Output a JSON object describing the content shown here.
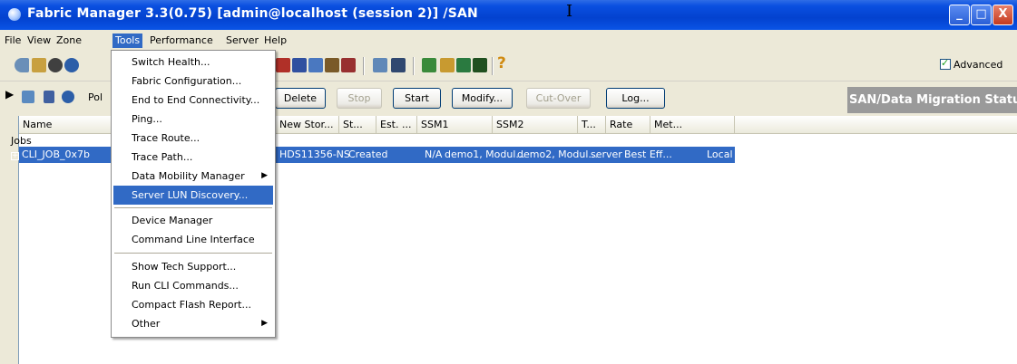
{
  "window": {
    "title": "Fabric Manager 3.3(0.75) [admin@localhost (session 2)] /SAN",
    "controls": [
      "_",
      "□",
      "X"
    ]
  },
  "menubar": [
    "File",
    "View",
    "Zone",
    "Tools",
    "Performance",
    "Server",
    "Help"
  ],
  "toolbar": {
    "advanced_label": "Advanced",
    "advanced_checked": true
  },
  "tools_menu": {
    "items": [
      {
        "label": "Switch Health..."
      },
      {
        "label": "Fabric Configuration..."
      },
      {
        "label": "End to End Connectivity..."
      },
      {
        "label": "Ping..."
      },
      {
        "label": "Trace Route..."
      },
      {
        "label": "Trace Path..."
      },
      {
        "label": "Data Mobility Manager",
        "submenu": true
      },
      {
        "label": "Server LUN Discovery...",
        "highlighted": true
      },
      {
        "label": "Device Manager"
      },
      {
        "label": "Command Line Interface"
      },
      {
        "label": "Show Tech Support..."
      },
      {
        "label": "Run CLI Commands..."
      },
      {
        "label": "Compact Flash Report..."
      },
      {
        "label": "Other",
        "submenu": true
      }
    ]
  },
  "actionbar": {
    "left_text": "Pol",
    "buttons": [
      {
        "label": "Delete",
        "enabled": true
      },
      {
        "label": "Stop",
        "enabled": false
      },
      {
        "label": "Start",
        "enabled": true
      },
      {
        "label": "Modify...",
        "enabled": true
      },
      {
        "label": "Cut-Over",
        "enabled": false
      },
      {
        "label": "Log...",
        "enabled": true
      }
    ],
    "status_title": "SAN/Data Migration Status"
  },
  "table": {
    "columns": [
      "Name",
      "New Stor...",
      "St...",
      "Est. ...",
      "SSM1",
      "SSM2",
      "T...",
      "Rate",
      "Met..."
    ],
    "group_label": "Jobs",
    "rows": [
      {
        "name": "CLI_JOB_0x7b",
        "new_storage": "HDS11356-NS",
        "status": "Created",
        "est": "N/A",
        "ssm1": "demo1, Modul...",
        "ssm2": "demo2, Modul...",
        "type": "server",
        "rate": "Best Eff...",
        "method": "Local"
      }
    ]
  },
  "colors": {
    "titlebar": "#0342cf",
    "selection": "#316ac5",
    "face": "#ece9d8",
    "status_header": "#9a9a9a"
  }
}
